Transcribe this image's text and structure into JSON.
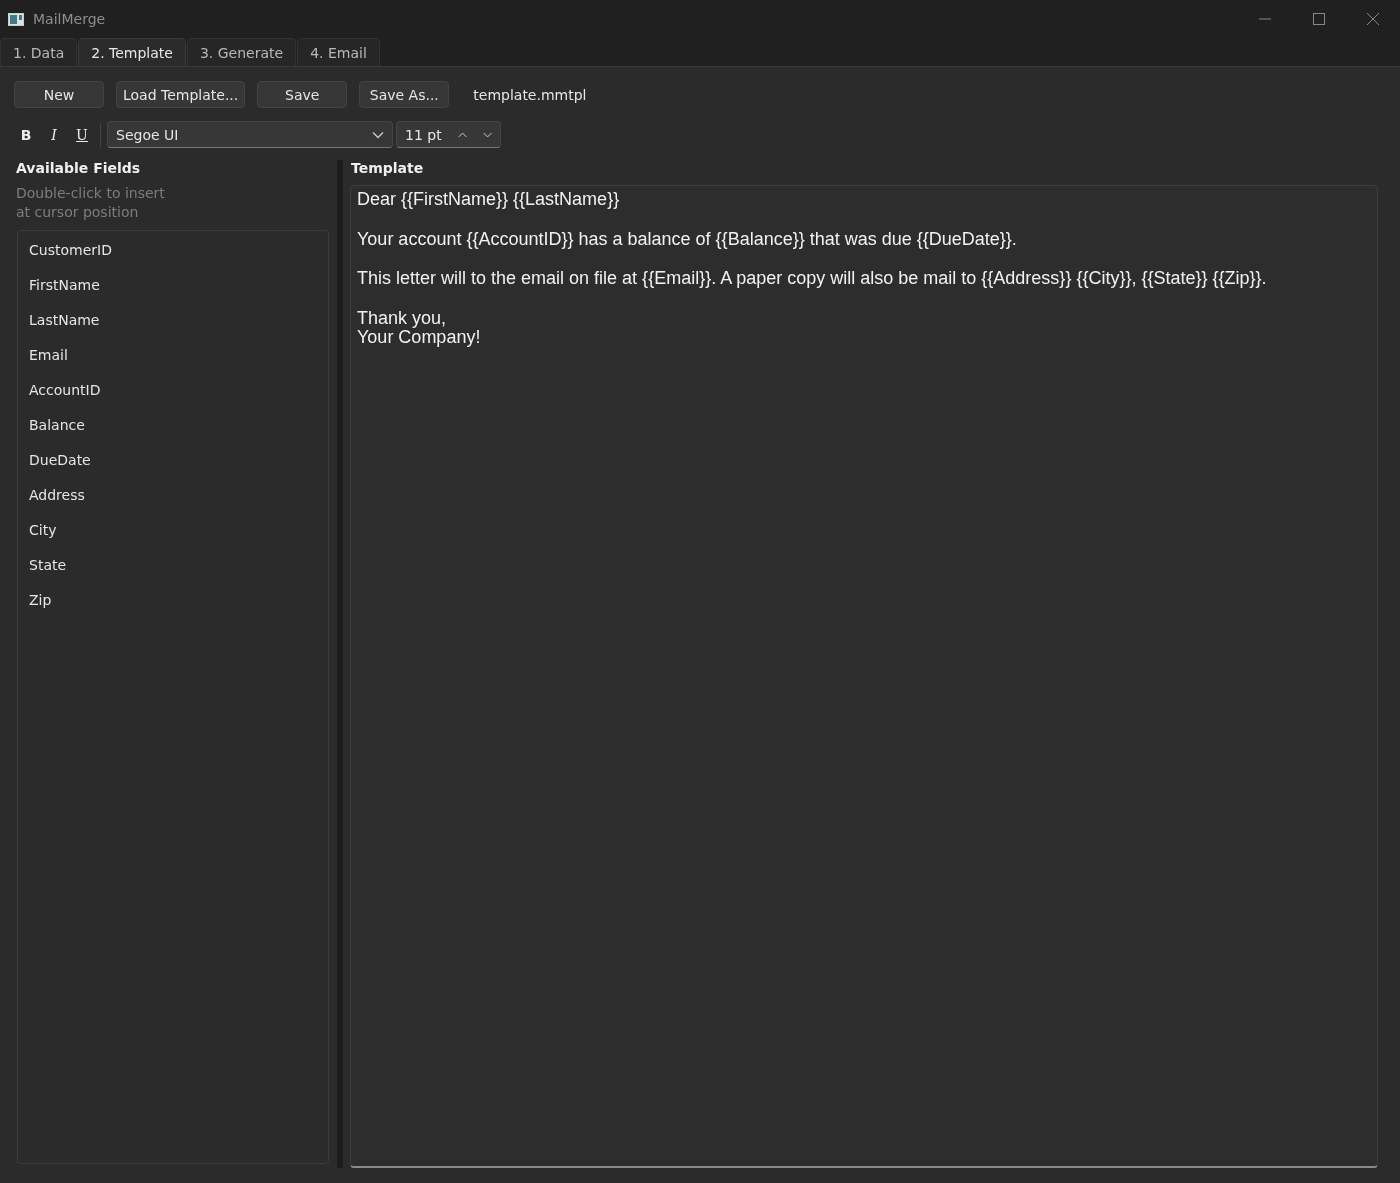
{
  "window": {
    "title": "MailMerge"
  },
  "tabs": [
    {
      "label": "1. Data",
      "selected": false
    },
    {
      "label": "2. Template",
      "selected": true
    },
    {
      "label": "3. Generate",
      "selected": false
    },
    {
      "label": "4. Email",
      "selected": false
    }
  ],
  "toolbar": {
    "buttons": [
      "New",
      "Load Template...",
      "Save",
      "Save As..."
    ],
    "file_name": "template.mmtpl"
  },
  "format_bar": {
    "bold": "B",
    "italic": "I",
    "underline": "U",
    "font": "Segoe UI",
    "size": "11 pt"
  },
  "fields_panel": {
    "title": "Available Fields",
    "hint": "Double-click to insert at cursor position",
    "items": [
      "CustomerID",
      "FirstName",
      "LastName",
      "Email",
      "AccountID",
      "Balance",
      "DueDate",
      "Address",
      "City",
      "State",
      "Zip"
    ]
  },
  "template_panel": {
    "title": "Template",
    "paragraphs": [
      {
        "lines": [
          "Dear {{FirstName}} {{LastName}}"
        ]
      },
      {
        "lines": [
          "Your account {{AccountID}} has a balance of {{Balance}} that was due {{DueDate}}."
        ]
      },
      {
        "lines": [
          "This letter will to the email on file at {{Email}}. A paper copy will also be mail to {{Address}} {{City}}, {{State}} {{Zip}}."
        ]
      },
      {
        "lines": [
          "Thank you,",
          "Your Company!"
        ]
      }
    ]
  }
}
